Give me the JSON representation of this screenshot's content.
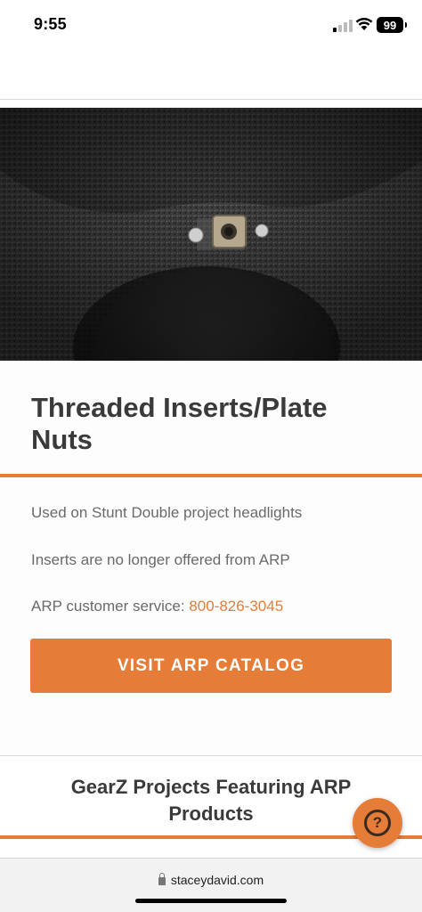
{
  "status_bar": {
    "time": "9:55",
    "battery": "99"
  },
  "hero": {
    "icon": "threaded-insert-photo"
  },
  "card": {
    "title": "Threaded Inserts/Plate Nuts",
    "line1": "Used on Stunt Double project headlights",
    "line2": "Inserts are no longer offered from ARP",
    "line3_prefix": "ARP customer service: ",
    "phone": "800-826-3045",
    "cta_label": "VISIT ARP CATALOG"
  },
  "section": {
    "title": "GearZ Projects Featuring ARP Products"
  },
  "help": {
    "label": "?"
  },
  "browser": {
    "url": "staceydavid.com"
  },
  "colors": {
    "accent": "#e57c37",
    "heading": "#3a3a3a",
    "body_text": "#6a6a6a"
  }
}
